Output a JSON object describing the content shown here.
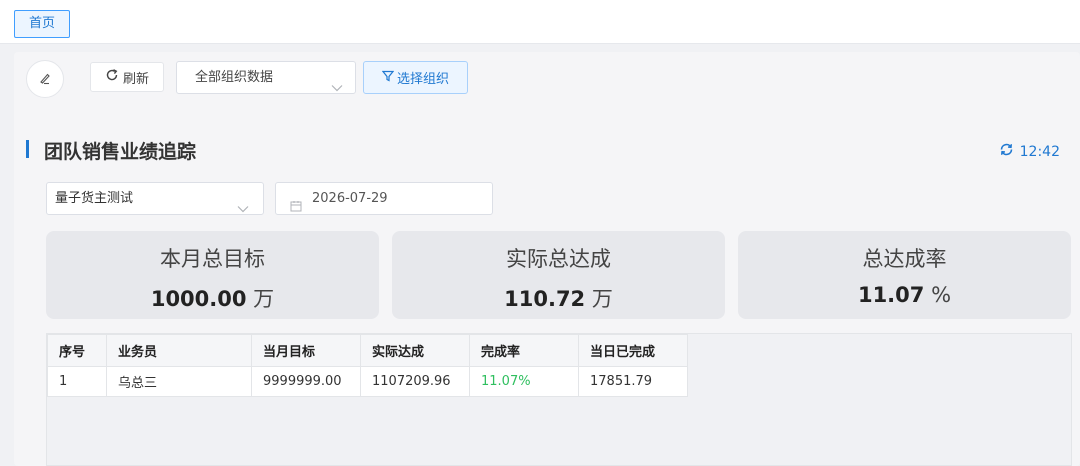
{
  "topbar": {
    "home_tab": "首页"
  },
  "toolbar": {
    "refresh_label": "刷新",
    "org_select_value": "全部组织数据",
    "choose_org_label": "选择组织"
  },
  "panel": {
    "title": "团队销售业绩追踪",
    "time": "12:42",
    "owner_select_value": "量子货主测试",
    "date_value": "2026-07-29"
  },
  "stats": [
    {
      "label": "本月总目标",
      "value": "1000.00",
      "unit": "万"
    },
    {
      "label": "实际总达成",
      "value": "110.72",
      "unit": "万"
    },
    {
      "label": "总达成率",
      "value": "11.07",
      "unit": "%"
    }
  ],
  "table": {
    "headers": [
      "序号",
      "业务员",
      "当月目标",
      "实际达成",
      "完成率",
      "当日已完成"
    ],
    "rows": [
      [
        "1",
        "乌总三",
        "9999999.00",
        "1107209.96",
        "11.07%",
        "17851.79"
      ]
    ]
  },
  "colors": {
    "accent": "#1f78d1",
    "success": "#2fbf5f"
  }
}
